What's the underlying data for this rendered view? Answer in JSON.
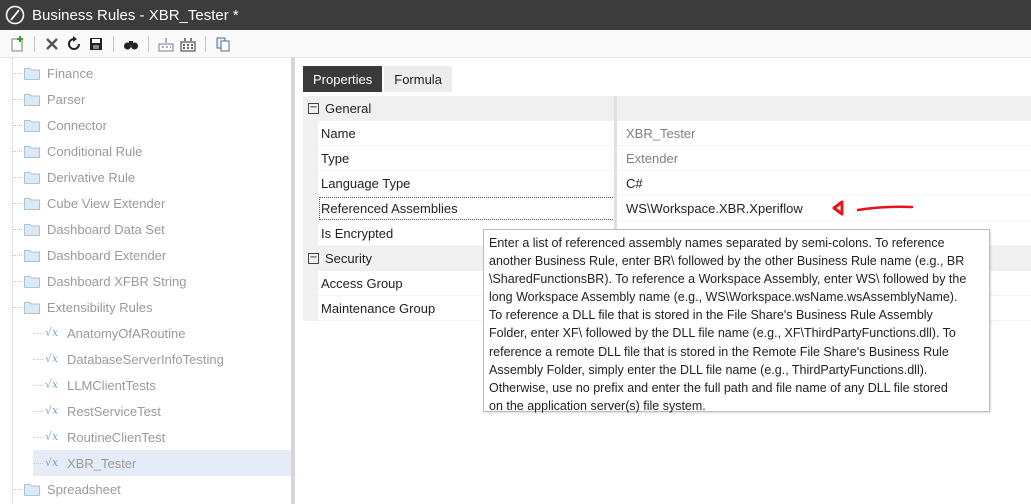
{
  "window": {
    "title": "Business Rules - XBR_Tester *"
  },
  "toolbar": {
    "buttons": [
      "add-rule-icon",
      "delete-icon",
      "refresh-icon",
      "save-icon",
      "search-icon",
      "compile-icon",
      "compile-all-icon",
      "copy-icon"
    ]
  },
  "tree": {
    "items": [
      {
        "label": "Finance",
        "type": "folder"
      },
      {
        "label": "Parser",
        "type": "folder"
      },
      {
        "label": "Connector",
        "type": "folder"
      },
      {
        "label": "Conditional Rule",
        "type": "folder"
      },
      {
        "label": "Derivative Rule",
        "type": "folder"
      },
      {
        "label": "Cube View Extender",
        "type": "folder"
      },
      {
        "label": "Dashboard Data Set",
        "type": "folder"
      },
      {
        "label": "Dashboard Extender",
        "type": "folder"
      },
      {
        "label": "Dashboard XFBR String",
        "type": "folder"
      },
      {
        "label": "Extensibility Rules",
        "type": "folder"
      },
      {
        "label": "AnatomyOfARoutine",
        "type": "rule"
      },
      {
        "label": "DatabaseServerInfoTesting",
        "type": "rule"
      },
      {
        "label": "LLMClientTests",
        "type": "rule"
      },
      {
        "label": "RestServiceTest",
        "type": "rule"
      },
      {
        "label": "RoutineClienTest",
        "type": "rule"
      },
      {
        "label": "XBR_Tester",
        "type": "rule",
        "selected": true
      },
      {
        "label": "Spreadsheet",
        "type": "folder"
      }
    ]
  },
  "tabs": [
    {
      "label": "Properties",
      "active": true
    },
    {
      "label": "Formula",
      "active": false
    }
  ],
  "properties": {
    "general": {
      "label": "General",
      "toggle": "−",
      "rows": [
        {
          "name": "Name",
          "value": "XBR_Tester"
        },
        {
          "name": "Type",
          "value": "Extender"
        },
        {
          "name": "Language Type",
          "value": "C#"
        },
        {
          "name": "Referenced Assemblies",
          "value": "WS\\Workspace.XBR.Xperiflow"
        },
        {
          "name": "Is Encrypted",
          "value": ""
        }
      ]
    },
    "security": {
      "label": "Security",
      "toggle": "−",
      "rows": [
        {
          "name": "Access Group",
          "value": ""
        },
        {
          "name": "Maintenance Group",
          "value": ""
        }
      ]
    }
  },
  "tooltip": {
    "lines": [
      "Enter a list of referenced assembly names separated by semi-colons. To reference",
      "another Business Rule, enter BR\\ followed by the other Business Rule name (e.g., BR",
      "\\SharedFunctionsBR). To reference a Workspace Assembly, enter WS\\ followed by the",
      "long Workspace Assembly name (e.g., WS\\Workspace.wsName.wsAssemblyName).",
      "To reference a DLL file that is stored in the File Share's Business Rule Assembly",
      "Folder, enter XF\\ followed by the DLL file name (e.g., XF\\ThirdPartyFunctions.dll). To",
      "reference a remote DLL file that is stored in the Remote File Share's Business Rule",
      "Assembly Folder, simply enter the DLL file name (e.g., ThirdPartyFunctions.dll).",
      "Otherwise, use no prefix and enter the full path and file name of any DLL file stored",
      "on the application server(s) file system."
    ]
  },
  "colors": {
    "titlebar": "#3c3c3c",
    "active_tab": "#3a3a3a",
    "annotation": "#e8121b",
    "selection": "#e5ecf8"
  }
}
